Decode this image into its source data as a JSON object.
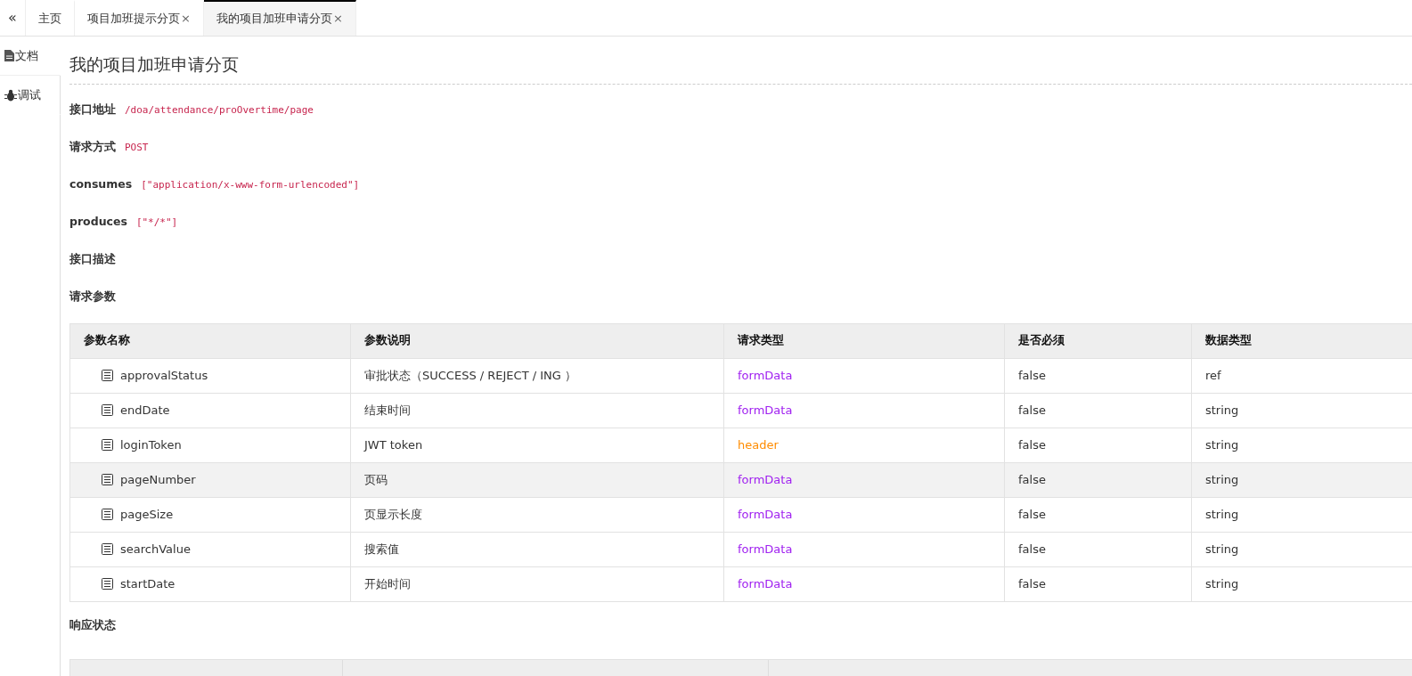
{
  "tab_bar": {
    "collapse_button": "«",
    "tabs": [
      {
        "label": "主页",
        "closable": false,
        "selected": false
      },
      {
        "label": "项目加班提示分页",
        "closable": true,
        "close": "×",
        "selected": false
      },
      {
        "label": "我的项目加班申请分页",
        "closable": true,
        "close": "×",
        "selected": true
      }
    ]
  },
  "sidebar": {
    "items": [
      {
        "label": "文档",
        "kind": "doc",
        "selected": true
      },
      {
        "label": "调试",
        "kind": "debug",
        "selected": false
      }
    ]
  },
  "page": {
    "title": "我的项目加班申请分页",
    "fields": [
      {
        "label": "接口地址",
        "value": "/doa/attendance/proOvertime/page"
      },
      {
        "label": "请求方式",
        "value": "POST"
      },
      {
        "label": "consumes",
        "value": "[\"application/x-www-form-urlencoded\"]"
      },
      {
        "label": "produces",
        "value": "[\"*/*\"]"
      },
      {
        "label": "接口描述"
      }
    ],
    "params_heading": "请求参数",
    "params_table": {
      "columns": [
        "参数名称",
        "参数说明",
        "请求类型",
        "是否必须",
        "数据类型"
      ],
      "rows": [
        {
          "name": "approvalStatus",
          "description": "审批状态（SUCCESS / REJECT / ING ）",
          "in": "formData",
          "color": "#a020f0",
          "required": "false",
          "type": "ref",
          "highlighted": false
        },
        {
          "name": "endDate",
          "description": "结束时间",
          "in": "formData",
          "color": "#a020f0",
          "required": "false",
          "type": "string",
          "highlighted": false
        },
        {
          "name": "loginToken",
          "description": "JWT token",
          "in": "header",
          "color": "#ff8c00",
          "required": "false",
          "type": "string",
          "highlighted": false
        },
        {
          "name": "pageNumber",
          "description": "页码",
          "in": "formData",
          "color": "#a020f0",
          "required": "false",
          "type": "string",
          "highlighted": true
        },
        {
          "name": "pageSize",
          "description": "页显示长度",
          "in": "formData",
          "color": "#a020f0",
          "required": "false",
          "type": "string",
          "highlighted": false
        },
        {
          "name": "searchValue",
          "description": "搜索值",
          "in": "formData",
          "color": "#a020f0",
          "required": "false",
          "type": "string",
          "highlighted": false
        },
        {
          "name": "startDate",
          "description": "开始时间",
          "in": "formData",
          "color": "#a020f0",
          "required": "false",
          "type": "string",
          "highlighted": false
        }
      ]
    },
    "response_heading": "响应状态"
  }
}
